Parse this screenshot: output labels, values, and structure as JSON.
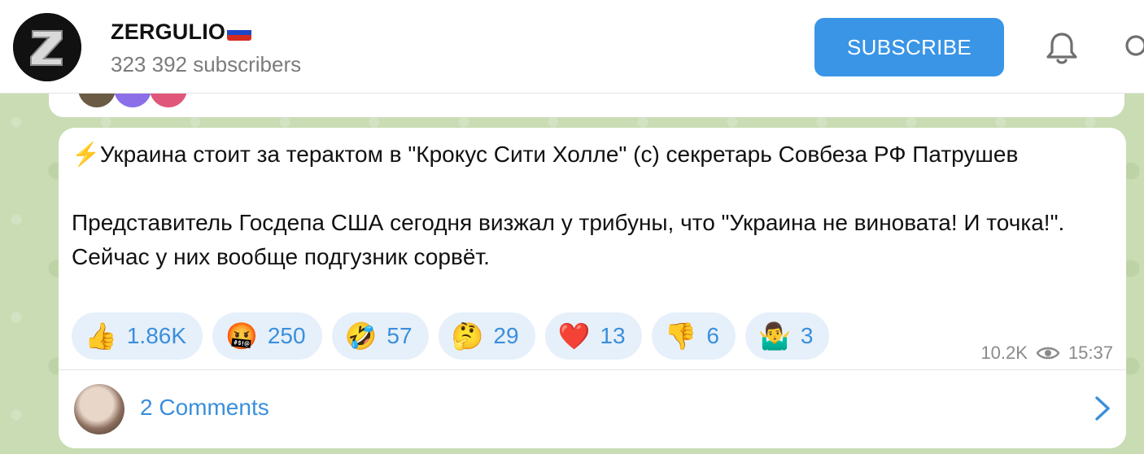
{
  "channel": {
    "name": "ZERGULIO",
    "subscribers": "323 392 subscribers",
    "subscribe_label": "SUBSCRIBE",
    "avatar_letter": "Z"
  },
  "post": {
    "line1": "⚡Украина стоит за терактом в \"Крокус Сити Холле\" (с) секретарь Совбеза РФ Патрушев",
    "line2": "Представитель Госдепа США сегодня визжал у трибуны, что \"Украина не виновата! И точка!\". Сейчас у них вообще подгузник сорвёт.",
    "reactions": [
      {
        "emoji": "👍",
        "icon": "thumbs-up",
        "count": "1.86K"
      },
      {
        "emoji": "🤬",
        "icon": "cursing-face",
        "count": "250"
      },
      {
        "emoji": "🤣",
        "icon": "rofl-face",
        "count": "57"
      },
      {
        "emoji": "🤔",
        "icon": "thinking-face",
        "count": "29"
      },
      {
        "emoji": "❤️",
        "icon": "red-heart",
        "count": "13"
      },
      {
        "emoji": "👎",
        "icon": "thumbs-down",
        "count": "6"
      },
      {
        "emoji": "🤷‍♂️",
        "icon": "shrug",
        "count": "3"
      }
    ],
    "views": "10.2K",
    "time": "15:37",
    "comments_label": "2 Comments"
  },
  "colors": {
    "accent": "#3a95e6",
    "link": "#3a8fdc",
    "reaction_bg": "#e6f0fa",
    "wallpaper": "#c9dcb4"
  }
}
